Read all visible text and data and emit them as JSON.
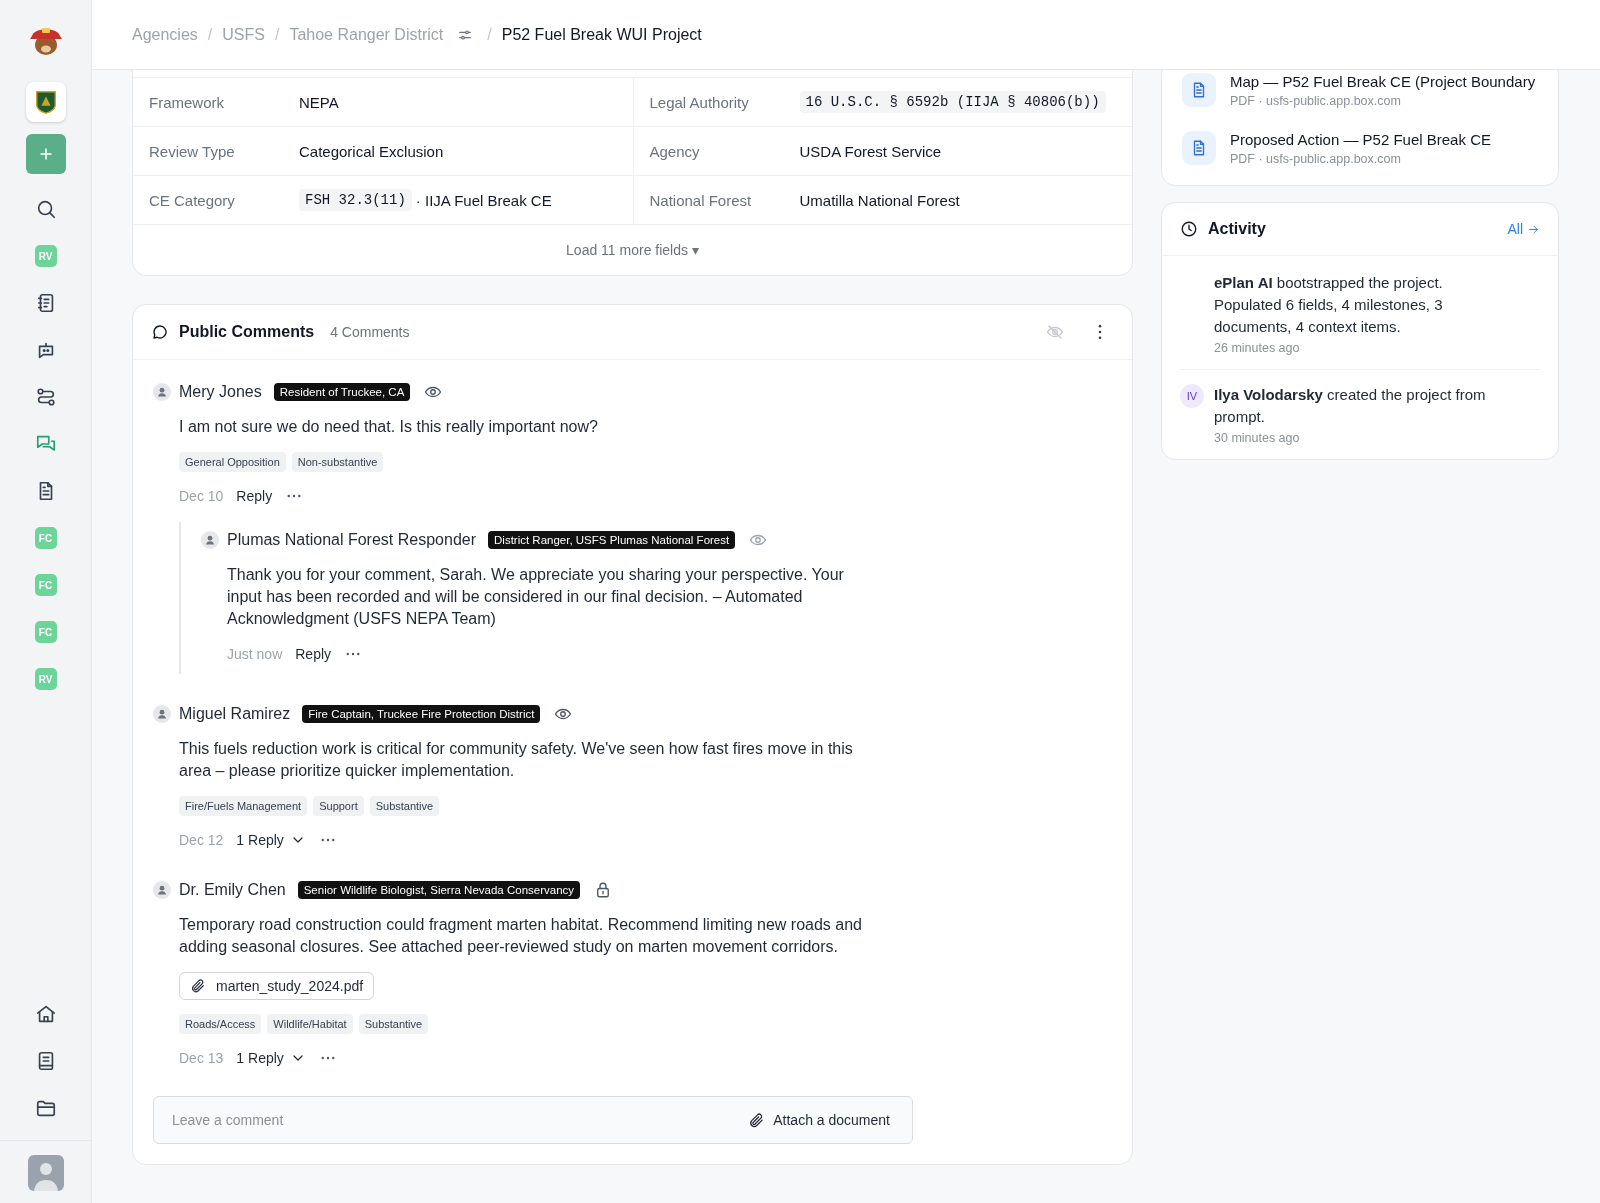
{
  "sidebar": {
    "items": [
      {
        "kind": "icon",
        "selected": false
      },
      {
        "kind": "badge",
        "label": "RV",
        "selected": false
      },
      {
        "kind": "icon",
        "selected": false
      },
      {
        "kind": "icon",
        "selected": false
      },
      {
        "kind": "icon",
        "selected": false
      },
      {
        "kind": "icon",
        "selected": true
      },
      {
        "kind": "icon",
        "selected": false
      },
      {
        "kind": "badge",
        "label": "FC",
        "selected": false
      },
      {
        "kind": "badge",
        "label": "FC",
        "selected": false
      },
      {
        "kind": "badge",
        "label": "FC",
        "selected": false
      },
      {
        "kind": "badge",
        "label": "RV",
        "selected": false
      }
    ],
    "bottom_items": [
      {
        "kind": "icon",
        "selected": false
      },
      {
        "kind": "icon",
        "selected": false
      },
      {
        "kind": "icon",
        "selected": false
      }
    ]
  },
  "breadcrumb": {
    "items": [
      "Agencies",
      "USFS",
      "Tahoe Ranger District"
    ],
    "separator": "/",
    "current": "P52 Fuel Break WUI Project"
  },
  "fields": {
    "rows": [
      [
        {
          "label": "Framework",
          "value": "NEPA"
        },
        {
          "label": "Legal Authority",
          "code": "16 U.S.C. § 6592b (IIJA § 40806(b))"
        }
      ],
      [
        {
          "label": "Review Type",
          "value": "Categorical Exclusion"
        },
        {
          "label": "Agency",
          "value": "USDA Forest Service"
        }
      ],
      [
        {
          "label": "CE Category",
          "code": "FSH 32.3(11)",
          "value": "· IIJA Fuel Break CE"
        },
        {
          "label": "National Forest",
          "value": "Umatilla National Forest"
        }
      ]
    ],
    "load_more": "Load 11 more fields ▾"
  },
  "public_comments": {
    "title": "Public Comments",
    "count": "4 Comments",
    "comments": [
      {
        "author": "Mery Jones",
        "role": "Resident of Truckee, CA",
        "private": false,
        "text": "I am not sure we do need that. Is this really important now?",
        "tags": [
          "General Opposition",
          "Non-substantive"
        ],
        "date": "Dec 10",
        "reply": {
          "label": "Reply",
          "kind": "link"
        },
        "replies": [
          {
            "author": "Plumas National Forest Responder",
            "role": "District Ranger, USFS Plumas National Forest",
            "private": false,
            "text": "Thank you for your comment, Sarah. We appreciate you sharing your perspective. Your input has been recorded and will be considered in our final decision. – Automated Acknowledgment (USFS NEPA Team)",
            "date": "Just now",
            "reply": {
              "label": "Reply",
              "kind": "link"
            }
          }
        ]
      },
      {
        "author": "Miguel Ramirez",
        "role": "Fire Captain, Truckee Fire Protection District",
        "private": false,
        "text": "This fuels reduction work is critical for community safety. We've seen how fast fires move in this area – please prioritize quicker implementation.",
        "tags": [
          "Fire/Fuels Management",
          "Support",
          "Substantive"
        ],
        "date": "Dec 12",
        "reply": {
          "label": "1 Reply",
          "kind": "toggle",
          "expanded": false
        }
      },
      {
        "author": "Dr. Emily Chen",
        "role": "Senior Wildlife Biologist, Sierra Nevada Conservancy",
        "private": true,
        "text": "Temporary road construction could fragment marten habitat. Recommend limiting new roads and adding seasonal closures. See attached peer-reviewed study on marten movement corridors.",
        "attachment": "marten_study_2024.pdf",
        "tags": [
          "Roads/Access",
          "Wildlife/Habitat",
          "Substantive"
        ],
        "date": "Dec 13",
        "reply": {
          "label": "1 Reply",
          "kind": "toggle",
          "expanded": false
        }
      }
    ],
    "input": {
      "placeholder": "Leave a comment",
      "attach": "Attach a document"
    }
  },
  "documents": [
    {
      "title": "Map — P52 Fuel Break CE (Project Boundary",
      "meta": "PDF · usfs-public.app.box.com"
    },
    {
      "title": "Proposed Action — P52 Fuel Break CE",
      "meta": "PDF · usfs-public.app.box.com"
    }
  ],
  "activity": {
    "title": "Activity",
    "link": "All",
    "entries": [
      {
        "text": "**ePlan AI** bootstrapped the project. Populated 6 fields, 4 milestones, 3 documents, 4 context items.",
        "time": "26 minutes ago"
      },
      {
        "avatar": "IV",
        "text": "**Ilya Volodarsky** created the project from prompt.",
        "time": "30 minutes ago"
      }
    ]
  }
}
